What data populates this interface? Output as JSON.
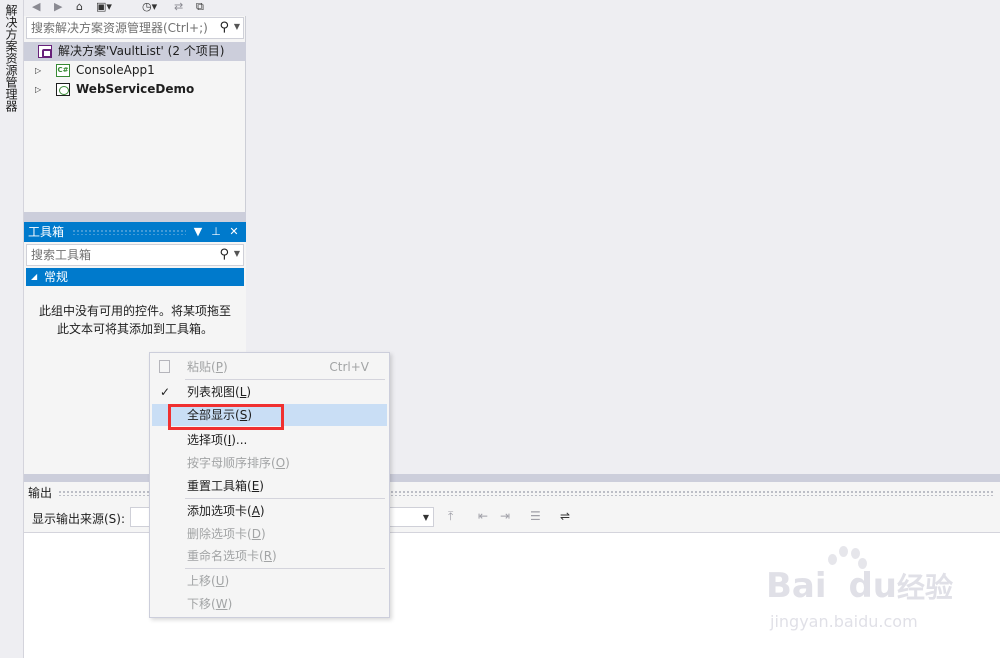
{
  "vertical_tab": "解决方案资源管理器",
  "solution_explorer": {
    "search_placeholder": "搜索解决方案资源管理器(Ctrl+;)",
    "items": [
      {
        "label": "解决方案'VaultList' (2 个项目)"
      },
      {
        "label": "ConsoleApp1"
      },
      {
        "label": "WebServiceDemo"
      }
    ]
  },
  "toolbox": {
    "title": "工具箱",
    "search_placeholder": "搜索工具箱",
    "group": "常规",
    "empty_line1": "此组中没有可用的控件。将某项拖至",
    "empty_line2": "此文本可将其添加到工具箱。"
  },
  "output": {
    "title": "输出",
    "source_label": "显示输出来源(S):"
  },
  "context_menu": {
    "paste": {
      "label": "粘贴(",
      "key": "P",
      "end": ")",
      "shortcut": "Ctrl+V"
    },
    "list_view": {
      "label": "列表视图(",
      "key": "L",
      "end": ")"
    },
    "show_all": {
      "label": "全部显示(",
      "key": "S",
      "end": ")"
    },
    "choose_items": {
      "label": "选择项(",
      "key": "I",
      "end": ")..."
    },
    "sort_alpha": {
      "label": "按字母顺序排序(",
      "key": "O",
      "end": ")"
    },
    "reset_toolbox": {
      "label": "重置工具箱(",
      "key": "E",
      "end": ")"
    },
    "add_tab": {
      "label": "添加选项卡(",
      "key": "A",
      "end": ")"
    },
    "delete_tab": {
      "label": "删除选项卡(",
      "key": "D",
      "end": ")"
    },
    "rename_tab": {
      "label": "重命名选项卡(",
      "key": "R",
      "end": ")"
    },
    "move_up": {
      "label": "上移(",
      "key": "U",
      "end": ")"
    },
    "move_down": {
      "label": "下移(",
      "key": "W",
      "end": ")"
    }
  },
  "watermark": {
    "brand_left": "Bai",
    "brand_right": "du",
    "brand_cn": "经验",
    "url": "jingyan.baidu.com"
  },
  "colors": {
    "accent": "#007acc",
    "highlight": "#f03030",
    "hover": "#c9def5"
  }
}
